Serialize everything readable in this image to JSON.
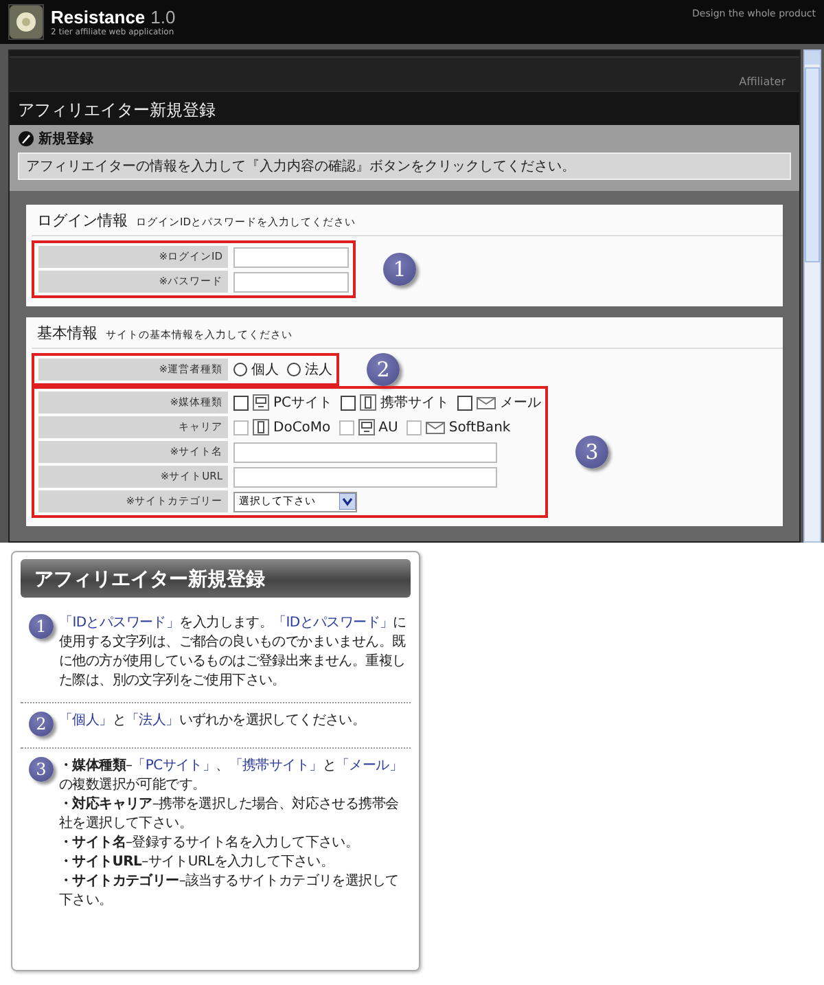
{
  "header": {
    "title": "Resistance",
    "version": "1.0",
    "subtitle": "2 tier affiliate web application",
    "tagline": "Design the whole product"
  },
  "nav": {
    "label": "Affiliater"
  },
  "page_title": "アフィリエイター新規登録",
  "panel": {
    "heading": "新規登録",
    "message": "アフィリエイターの情報を入力して『入力内容の確認』ボタンをクリックしてください。"
  },
  "sections": [
    {
      "title": "ログイン情報",
      "hint": "ログインIDとパスワードを入力してください",
      "groups": [
        {
          "marker": "1",
          "rows": [
            {
              "label": "※ログインID",
              "kind": "text"
            },
            {
              "label": "※パスワード",
              "kind": "text"
            }
          ]
        }
      ]
    },
    {
      "title": "基本情報",
      "hint": "サイトの基本情報を入力してください",
      "groups": [
        {
          "marker": "2",
          "rows": [
            {
              "label": "※運営者種類",
              "kind": "radio",
              "options": [
                {
                  "label": "個人",
                  "selected": false
                },
                {
                  "label": "法人",
                  "selected": false
                }
              ]
            }
          ]
        },
        {
          "marker": "3",
          "rows": [
            {
              "label": "※媒体種類",
              "kind": "checkbox",
              "disabled": false,
              "options": [
                {
                  "label": "PCサイト",
                  "checked": false
                },
                {
                  "label": "携帯サイト",
                  "checked": false
                },
                {
                  "label": "メール",
                  "checked": false
                }
              ]
            },
            {
              "label": "キャリア",
              "kind": "checkbox",
              "disabled": true,
              "options": [
                {
                  "label": "DoCoMo",
                  "checked": false
                },
                {
                  "label": "AU",
                  "checked": false
                },
                {
                  "label": "SoftBank",
                  "checked": false
                }
              ]
            },
            {
              "label": "※サイト名",
              "kind": "text"
            },
            {
              "label": "※サイトURL",
              "kind": "text"
            },
            {
              "label": "※サイトカテゴリー",
              "kind": "select",
              "value": "選択して下さい"
            }
          ]
        }
      ]
    }
  ],
  "notes": {
    "title": "アフィリエイター新規登録",
    "items": [
      {
        "number": "1",
        "lines": [
          [
            {
              "kind": "link",
              "text": "「IDとパスワード」"
            },
            {
              "kind": "plain",
              "text": "を入力します。"
            },
            {
              "kind": "link",
              "text": "「IDとパスワード」"
            },
            {
              "kind": "plain",
              "text": "に使用する文字列は、ご都合の良いものでかまいません。既に他の方が使用しているものはご登録出来ません。重複した際は、別の文字列をご使用下さい。"
            }
          ]
        ]
      },
      {
        "number": "2",
        "lines": [
          [
            {
              "kind": "link",
              "text": "「個人」"
            },
            {
              "kind": "plain",
              "text": "と"
            },
            {
              "kind": "link",
              "text": "「法人」"
            },
            {
              "kind": "plain",
              "text": "いずれかを選択してください。"
            }
          ]
        ]
      },
      {
        "number": "3",
        "lines": [
          [
            {
              "kind": "bold",
              "text": "・媒体種類"
            },
            {
              "kind": "plain",
              "text": "–"
            },
            {
              "kind": "link",
              "text": "「PCサイト」"
            },
            {
              "kind": "plain",
              "text": "、"
            },
            {
              "kind": "link",
              "text": "「携帯サイト」"
            },
            {
              "kind": "plain",
              "text": "と"
            },
            {
              "kind": "link",
              "text": "「メール」"
            },
            {
              "kind": "plain",
              "text": "の複数選択が可能です。"
            }
          ],
          [
            {
              "kind": "bold",
              "text": "・対応キャリア"
            },
            {
              "kind": "plain",
              "text": "–携帯を選択した場合、対応させる携帯会社を選択して下さい。"
            }
          ],
          [
            {
              "kind": "bold",
              "text": "・サイト名"
            },
            {
              "kind": "plain",
              "text": "–登録するサイト名を入力して下さい。"
            }
          ],
          [
            {
              "kind": "bold",
              "text": "・サイトURL"
            },
            {
              "kind": "plain",
              "text": "–サイトURLを入力して下さい。"
            }
          ],
          [
            {
              "kind": "bold",
              "text": "・サイトカテゴリー"
            },
            {
              "kind": "plain",
              "text": "–該当するサイトカテゴリを選択して下さい。"
            }
          ]
        ]
      }
    ]
  }
}
